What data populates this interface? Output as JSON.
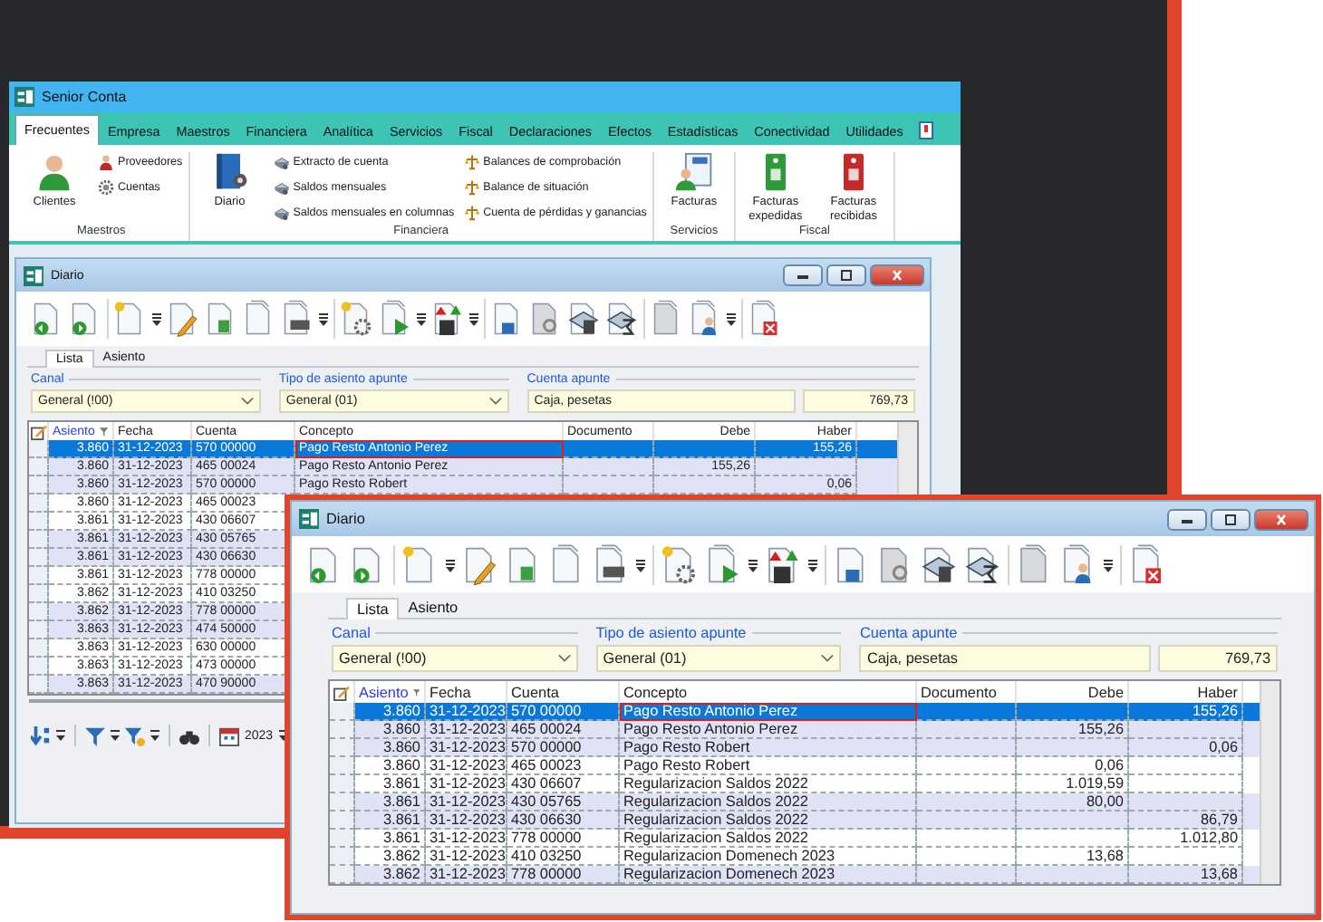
{
  "app_window": {
    "title": "Senior Conta",
    "ribbon_tabs": [
      {
        "label": "Frecuentes",
        "selected": true
      },
      {
        "label": "Empresa",
        "selected": false
      },
      {
        "label": "Maestros",
        "selected": false
      },
      {
        "label": "Financiera",
        "selected": false
      },
      {
        "label": "Analítica",
        "selected": false
      },
      {
        "label": "Servicios",
        "selected": false
      },
      {
        "label": "Fiscal",
        "selected": false
      },
      {
        "label": "Declaraciones",
        "selected": false
      },
      {
        "label": "Efectos",
        "selected": false
      },
      {
        "label": "Estadísticas",
        "selected": false
      },
      {
        "label": "Conectividad",
        "selected": false
      },
      {
        "label": "Utilidades",
        "selected": false
      }
    ],
    "ribbon_groups": [
      {
        "label": "Maestros",
        "columns": [
          {
            "items": [
              {
                "label": "Clientes",
                "kind": "large"
              }
            ]
          },
          {
            "items": [
              {
                "label": "Proveedores",
                "kind": "small"
              },
              {
                "label": "Cuentas",
                "kind": "small"
              }
            ]
          }
        ]
      },
      {
        "label": "Financiera",
        "columns": [
          {
            "items": [
              {
                "label": "Diario",
                "kind": "large"
              }
            ]
          },
          {
            "items": [
              {
                "label": "Extracto de cuenta",
                "kind": "small"
              },
              {
                "label": "Saldos mensuales",
                "kind": "small"
              },
              {
                "label": "Saldos mensuales en columnas",
                "kind": "small"
              }
            ]
          },
          {
            "items": [
              {
                "label": "Balances de comprobación",
                "kind": "small"
              },
              {
                "label": "Balance de situación",
                "kind": "small"
              },
              {
                "label": "Cuenta de pérdidas y ganancias",
                "kind": "small"
              }
            ]
          }
        ]
      },
      {
        "label": "Servicios",
        "columns": [
          {
            "items": [
              {
                "label": "Facturas",
                "kind": "large"
              }
            ]
          }
        ]
      },
      {
        "label": "Fiscal",
        "columns": [
          {
            "items": [
              {
                "label": "Facturas expedidas",
                "kind": "large"
              }
            ]
          },
          {
            "items": [
              {
                "label": "Facturas recibidas",
                "kind": "large"
              }
            ]
          }
        ]
      }
    ]
  },
  "back_window": {
    "title": "Diario",
    "tabs": [
      {
        "label": "Lista",
        "selected": true
      },
      {
        "label": "Asiento",
        "selected": false
      }
    ],
    "filters": [
      {
        "label": "Canal",
        "kind": "dropdown",
        "value": "General (!00)"
      },
      {
        "label": "Tipo de asiento apunte",
        "kind": "dropdown",
        "value": "General (01)"
      },
      {
        "label": "Cuenta apunte",
        "kind": "account",
        "value": "Caja, pesetas",
        "amount": "769,73"
      }
    ],
    "columns": [
      {
        "label": "Asiento",
        "sorted": true,
        "focused": false
      },
      {
        "label": "Fecha",
        "sorted": false,
        "focused": false
      },
      {
        "label": "Cuenta",
        "sorted": false,
        "focused": false
      },
      {
        "label": "Concepto",
        "sorted": false,
        "focused": true
      },
      {
        "label": "Documento",
        "sorted": false,
        "focused": false
      },
      {
        "label": "Debe",
        "sorted": false,
        "focused": false
      },
      {
        "label": "Haber",
        "sorted": false,
        "focused": false
      }
    ],
    "rows": [
      {
        "selected": true,
        "cells": [
          "3.860",
          "31-12-2023",
          "570 00000",
          "Pago Resto Antonio Perez",
          "",
          "",
          "155,26"
        ]
      },
      {
        "selected": false,
        "cells": [
          "3.860",
          "31-12-2023",
          "465 00024",
          "Pago Resto Antonio Perez",
          "",
          "155,26",
          ""
        ]
      },
      {
        "selected": false,
        "cells": [
          "3.860",
          "31-12-2023",
          "570 00000",
          "Pago Resto Robert",
          "",
          "",
          "0,06"
        ]
      },
      {
        "selected": false,
        "cells": [
          "3.860",
          "31-12-2023",
          "465 00023"
        ]
      },
      {
        "selected": false,
        "cells": [
          "3.861",
          "31-12-2023",
          "430 06607"
        ]
      },
      {
        "selected": false,
        "cells": [
          "3.861",
          "31-12-2023",
          "430 05765"
        ]
      },
      {
        "selected": false,
        "cells": [
          "3.861",
          "31-12-2023",
          "430 06630"
        ]
      },
      {
        "selected": false,
        "cells": [
          "3.861",
          "31-12-2023",
          "778 00000"
        ]
      },
      {
        "selected": false,
        "cells": [
          "3.862",
          "31-12-2023",
          "410 03250"
        ]
      },
      {
        "selected": false,
        "cells": [
          "3.862",
          "31-12-2023",
          "778 00000"
        ]
      },
      {
        "selected": false,
        "cells": [
          "3.863",
          "31-12-2023",
          "474 50000"
        ]
      },
      {
        "selected": false,
        "cells": [
          "3.863",
          "31-12-2023",
          "630 00000"
        ]
      },
      {
        "selected": false,
        "cells": [
          "3.863",
          "31-12-2023",
          "473 00000"
        ]
      },
      {
        "selected": false,
        "cells": [
          "3.863",
          "31-12-2023",
          "470 90000"
        ]
      }
    ],
    "year": "2023"
  },
  "front_window": {
    "title": "Diario",
    "tabs": [
      {
        "label": "Lista",
        "selected": true
      },
      {
        "label": "Asiento",
        "selected": false
      }
    ],
    "filters": [
      {
        "label": "Canal",
        "kind": "dropdown",
        "value": "General (!00)"
      },
      {
        "label": "Tipo de asiento apunte",
        "kind": "dropdown",
        "value": "General (01)"
      },
      {
        "label": "Cuenta apunte",
        "kind": "account",
        "value": "Caja, pesetas",
        "amount": "769,73"
      }
    ],
    "columns": [
      {
        "label": "Asiento",
        "sorted": true,
        "focused": false
      },
      {
        "label": "Fecha",
        "sorted": false,
        "focused": false
      },
      {
        "label": "Cuenta",
        "sorted": false,
        "focused": false
      },
      {
        "label": "Concepto",
        "sorted": false,
        "focused": true
      },
      {
        "label": "Documento",
        "sorted": false,
        "focused": false
      },
      {
        "label": "Debe",
        "sorted": false,
        "focused": false
      },
      {
        "label": "Haber",
        "sorted": false,
        "focused": false
      }
    ],
    "rows": [
      {
        "selected": true,
        "cells": [
          "3.860",
          "31-12-2023",
          "570 00000",
          "Pago Resto Antonio Perez",
          "",
          "",
          "155,26"
        ]
      },
      {
        "selected": false,
        "cells": [
          "3.860",
          "31-12-2023",
          "465 00024",
          "Pago Resto Antonio Perez",
          "",
          "155,26",
          ""
        ]
      },
      {
        "selected": false,
        "cells": [
          "3.860",
          "31-12-2023",
          "570 00000",
          "Pago Resto Robert",
          "",
          "",
          "0,06"
        ]
      },
      {
        "selected": false,
        "cells": [
          "3.860",
          "31-12-2023",
          "465 00023",
          "Pago Resto Robert",
          "",
          "0,06",
          ""
        ]
      },
      {
        "selected": false,
        "cells": [
          "3.861",
          "31-12-2023",
          "430 06607",
          "Regularizacion Saldos 2022",
          "",
          "1.019,59",
          ""
        ]
      },
      {
        "selected": false,
        "cells": [
          "3.861",
          "31-12-2023",
          "430 05765",
          "Regularizacion Saldos 2022",
          "",
          "80,00",
          ""
        ]
      },
      {
        "selected": false,
        "cells": [
          "3.861",
          "31-12-2023",
          "430 06630",
          "Regularizacion Saldos 2022",
          "",
          "",
          "86,79"
        ]
      },
      {
        "selected": false,
        "cells": [
          "3.861",
          "31-12-2023",
          "778 00000",
          "Regularizacion Saldos 2022",
          "",
          "",
          "1.012,80"
        ]
      },
      {
        "selected": false,
        "cells": [
          "3.862",
          "31-12-2023",
          "410 03250",
          "Regularizacion Domenech 2023",
          "",
          "13,68",
          ""
        ]
      },
      {
        "selected": false,
        "cells": [
          "3.862",
          "31-12-2023",
          "778 00000",
          "Regularizacion Domenech 2023",
          "",
          "",
          "13,68"
        ]
      }
    ]
  }
}
